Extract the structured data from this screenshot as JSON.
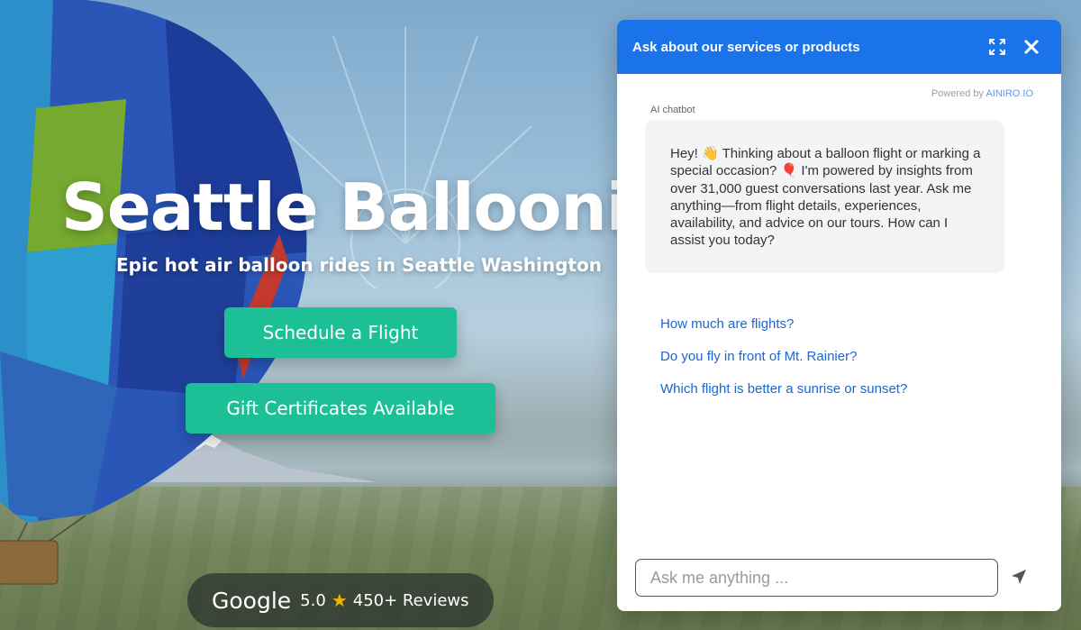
{
  "hero": {
    "title": "Seattle Ballooning",
    "subtitle": "Epic hot air balloon rides in Seattle Washington",
    "cta_primary": "Schedule a Flight",
    "cta_secondary": "Gift Certificates Available"
  },
  "google_badge": {
    "logo_text": "Google",
    "rating": "5.0",
    "star": "★",
    "reviews": "450+ Reviews"
  },
  "chat": {
    "header_title": "Ask about our services or products",
    "expand_icon": "expand-icon",
    "close_icon": "close-icon",
    "powered_prefix": "Powered by",
    "powered_brand": "AINIRO.IO",
    "bot_label": "AI chatbot",
    "greeting": "Hey! 👋 Thinking about a balloon flight or marking a special occasion? 🎈 I'm powered by insights from over 31,000 guest conversations last year. Ask me anything—from flight details, experiences, availability, and advice on our tours. How can I assist you today?",
    "suggestions": [
      "How much are flights?",
      "Do you fly in front of Mt. Rainier?",
      "Which flight is better a sunrise or sunset?"
    ],
    "input_placeholder": "Ask me anything ...",
    "send_icon": "send-icon"
  },
  "colors": {
    "chat_header": "#1a73e8",
    "cta": "#1dbf97",
    "link": "#1a67d2",
    "star": "#f5b400"
  }
}
